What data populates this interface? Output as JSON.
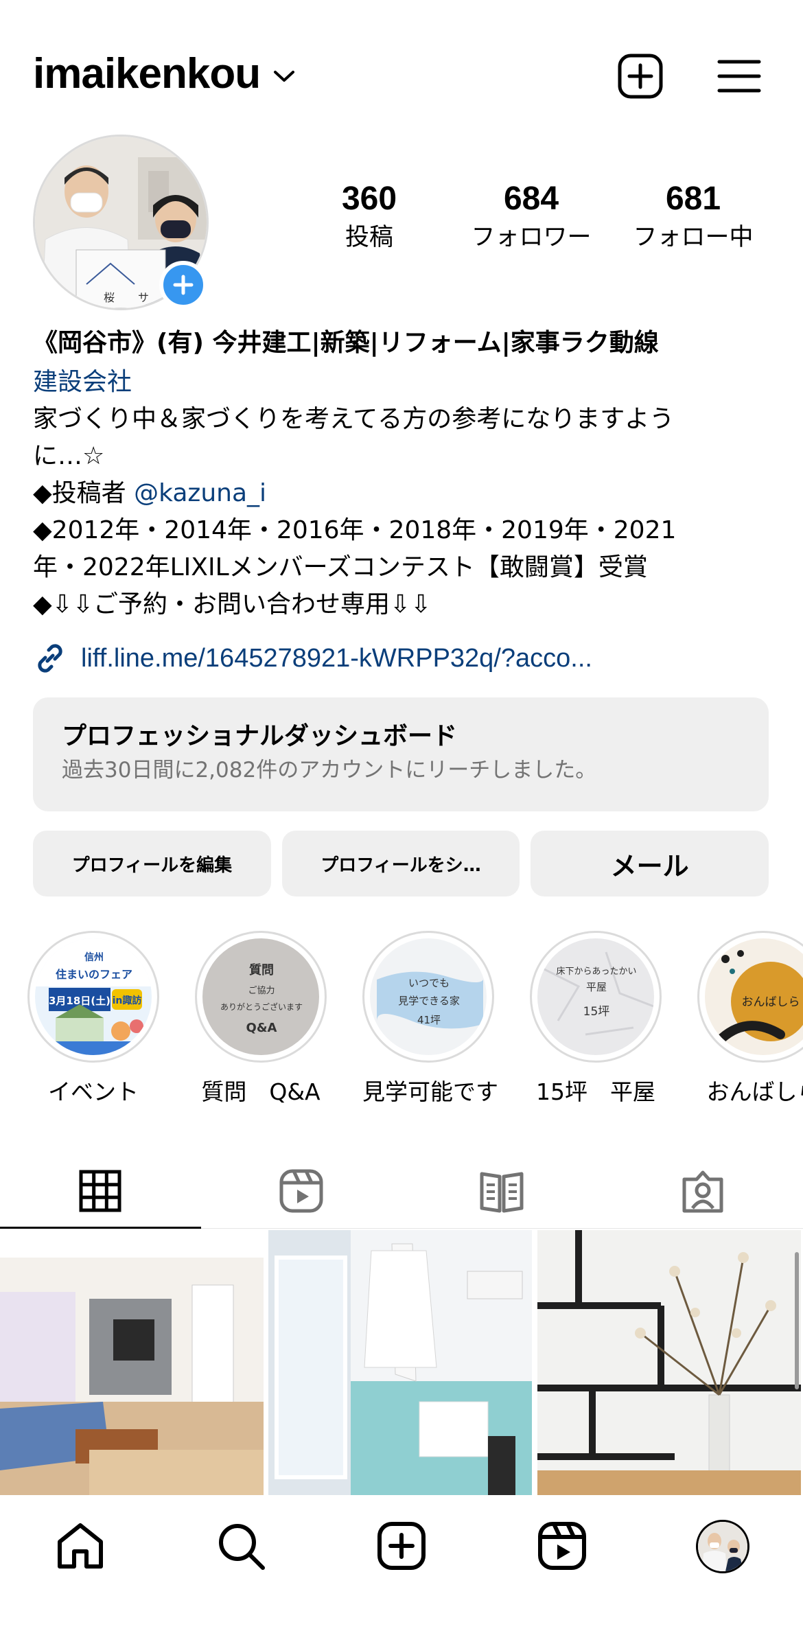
{
  "header": {
    "username": "imaikenkou"
  },
  "stats": [
    {
      "value": "360",
      "label": "投稿"
    },
    {
      "value": "684",
      "label": "フォロワー"
    },
    {
      "value": "681",
      "label": "フォロー中"
    }
  ],
  "bio": {
    "name": "《岡谷市》(有) 今井建工|新築|リフォーム|家事ラク動線",
    "category": "建設会社",
    "line1": "家づくり中＆家づくりを考えてる方の参考になりますよう",
    "line2": "に…☆",
    "line3_prefix": "◆投稿者 ",
    "line3_mention": "@kazuna_i",
    "line4": "◆2012年・2014年・2016年・2018年・2019年・2021",
    "line5": "年・2022年LIXILメンバーズコンテスト【敢闘賞】受賞",
    "line6": "◆⇩⇩ご予約・お問い合わせ専用⇩⇩",
    "link": "liff.line.me/1645278921-kWRPP32q/?acco..."
  },
  "dashboard": {
    "title": "プロフェッショナルダッシュボード",
    "subtitle": "過去30日間に2,082件のアカウントにリーチしました。"
  },
  "buttons": {
    "edit": "プロフィールを編集",
    "share": "プロフィールをシ…",
    "mail": "メール"
  },
  "highlights": [
    {
      "label": "イベント",
      "cover_lines": [
        "信州",
        "住まいのフェア",
        "3月18日(土)",
        "in諏訪"
      ]
    },
    {
      "label": "質問　Q&A",
      "cover_lines": [
        "質問",
        "ご協力",
        "ありがとうございます",
        "Q&A"
      ]
    },
    {
      "label": "見学可能です",
      "cover_lines": [
        "いつでも",
        "見学できる家",
        "41坪"
      ]
    },
    {
      "label": "15坪　平屋",
      "cover_lines": [
        "床下からあったかい",
        "平屋",
        "15坪"
      ]
    },
    {
      "label": "おんばしら",
      "cover_lines": [
        "おんばしら"
      ]
    }
  ],
  "avatar_sign": [
    "桜",
    "サ"
  ],
  "colors": {
    "link": "#0a3e7a",
    "badge": "#3797f0",
    "button_bg": "#efefef",
    "muted": "#737373"
  }
}
